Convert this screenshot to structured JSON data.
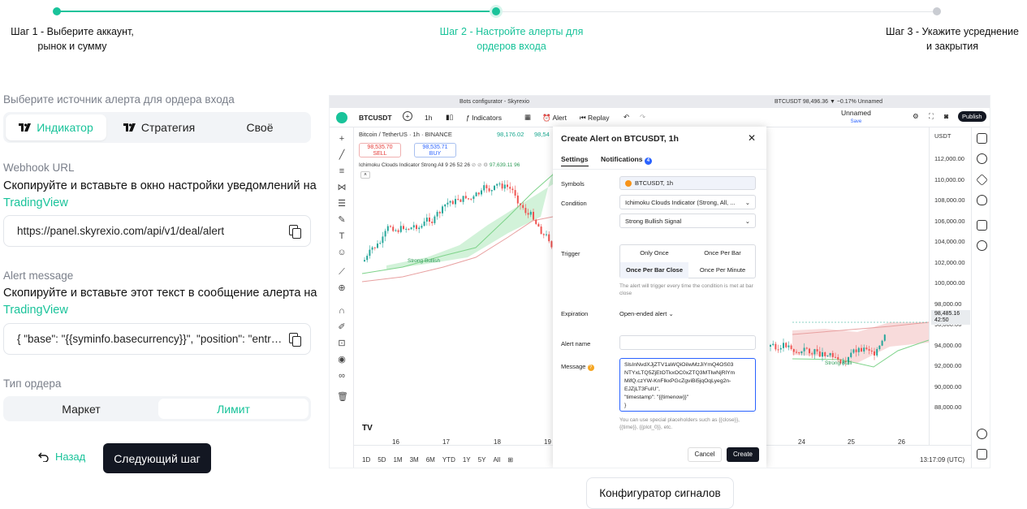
{
  "stepper": {
    "colors": {
      "active": "#19c39a",
      "inactive": "#c9ccd2"
    },
    "steps": [
      {
        "label_line1": "Шаг 1 - Выберите аккаунт,",
        "label_line2": "рынок и сумму"
      },
      {
        "label_line1": "Шаг 2 - Настройте алерты для",
        "label_line2": "ордеров входа"
      },
      {
        "label_line1": "Шаг 3 - Укажите усреднение",
        "label_line2": "и закрытия"
      }
    ]
  },
  "form": {
    "source_title": "Выберите источник алерта для ордера входа",
    "source_tabs": [
      {
        "label": "Индикатор",
        "icon": "tradingview-logo-icon",
        "selected": true
      },
      {
        "label": "Стратегия",
        "icon": "tradingview-logo-icon",
        "selected": false
      },
      {
        "label": "Своё",
        "selected": false
      }
    ],
    "webhook": {
      "title": "Webhook URL",
      "desc": "Скопируйте и вставьте в окно настройки уведомлений на",
      "link": "TradingView",
      "value": "https://panel.skyrexio.com/api/v1/deal/alert"
    },
    "alert_message": {
      "title": "Alert message",
      "desc": "Скопируйте и вставьте этот текст в сообщение алерта на",
      "link": "TradingView",
      "value": "{ \"base\": \"{{syminfo.basecurrency}}\", \"position\": \"entry1\",..."
    },
    "order_type": {
      "title": "Тип ордера",
      "options": [
        {
          "label": "Маркет",
          "selected": false
        },
        {
          "label": "Лимит",
          "selected": true
        }
      ]
    },
    "back_label": "Назад",
    "next_label": "Следующий шаг"
  },
  "screenshot": {
    "window_title_left": "Bots configurator - Skyrexio",
    "window_title_right": "BTCUSDT 98,496.36 ▼ −0.17% Unnamed",
    "toolbar": {
      "symbol": "BTCUSDT",
      "interval": "1h",
      "indicators_label": "Indicators",
      "alert_label": "Alert",
      "replay_label": "Replay",
      "layout_name": "Unnamed",
      "layout_status": "Save",
      "publish_label": "Publish"
    },
    "legend": {
      "title": "Bitcoin / TetherUS · 1h · BINANCE",
      "sell_price": "98,535.70",
      "sell_label": "SELL",
      "buy_price": "98,535.71",
      "buy_label": "BUY",
      "ohlc_open": "98,176.02",
      "ohlc_high_fragment": "98,54",
      "indicator_line": "Ichimoku Clouds Indicator Strong All 9 26 52 26",
      "indicator_value": "97,639.11",
      "indicator_value2": "96"
    },
    "chart_annotations": {
      "strong_bullish_left": "Strong Bullish",
      "strong_bullish_right": "Strong Bulli"
    },
    "price_axis": {
      "currency": "USDT",
      "ticks": [
        "112,000.00",
        "110,000.00",
        "108,000.00",
        "106,000.00",
        "104,000.00",
        "102,000.00",
        "100,000.00",
        "98,000.00",
        "96,000.00",
        "94,000.00",
        "92,000.00",
        "90,000.00",
        "88,000.00"
      ],
      "current_price": "98,485.16",
      "countdown": "42:50"
    },
    "time_axis": {
      "left_ticks": [
        "16",
        "17",
        "18",
        "19"
      ],
      "right_ticks": [
        "24",
        "25",
        "26"
      ]
    },
    "bottom_bar": {
      "ranges": [
        "1D",
        "5D",
        "1M",
        "3M",
        "6M",
        "YTD",
        "1Y",
        "5Y",
        "All"
      ],
      "clock": "13:17:09 (UTC)"
    },
    "modal": {
      "title": "Create Alert on BTCUSDT, 1h",
      "tabs": [
        {
          "label": "Settings",
          "active": true
        },
        {
          "label": "Notifications",
          "badge": "4"
        }
      ],
      "symbols_label": "Symbols",
      "symbols_value": "BTCUSDT, 1h",
      "condition_label": "Condition",
      "condition_value": "Ichimoku Clouds Indicator (Strong, All, ...",
      "condition_value2": "Strong Bullish Signal",
      "trigger_label": "Trigger",
      "trigger_options": [
        {
          "label": "Only Once",
          "selected": false
        },
        {
          "label": "Once Per Bar",
          "selected": false
        },
        {
          "label": "Once Per Bar Close",
          "selected": true
        },
        {
          "label": "Once Per Minute",
          "selected": false
        }
      ],
      "trigger_hint": "The alert will trigger every time the condition is met at bar close",
      "expiration_label": "Expiration",
      "expiration_value": "Open-ended alert",
      "alert_name_label": "Alert name",
      "message_label": "Message",
      "message_lines": [
        "SlsInNvdXJjZTV1aWQiOiIwMzJiYmQ4OS03",
        "NTYxLTQ5ZjEtOTkxOC0xZTQ3MTIwNjRlYm",
        "MifQ.czYW-KnFlkxPGcZgviBi5jqOqLyeg2n-",
        "EJZjLT3FuIU\",",
        "  \"timestamp\": \"{{timenow}}\"",
        "}"
      ],
      "placeholders_hint": "You can use special placeholders such as {{close}}, {{time}}, {{plot_0}}, etc.",
      "cancel_label": "Cancel",
      "create_label": "Create"
    }
  },
  "caption": "Конфигуратор сигналов"
}
